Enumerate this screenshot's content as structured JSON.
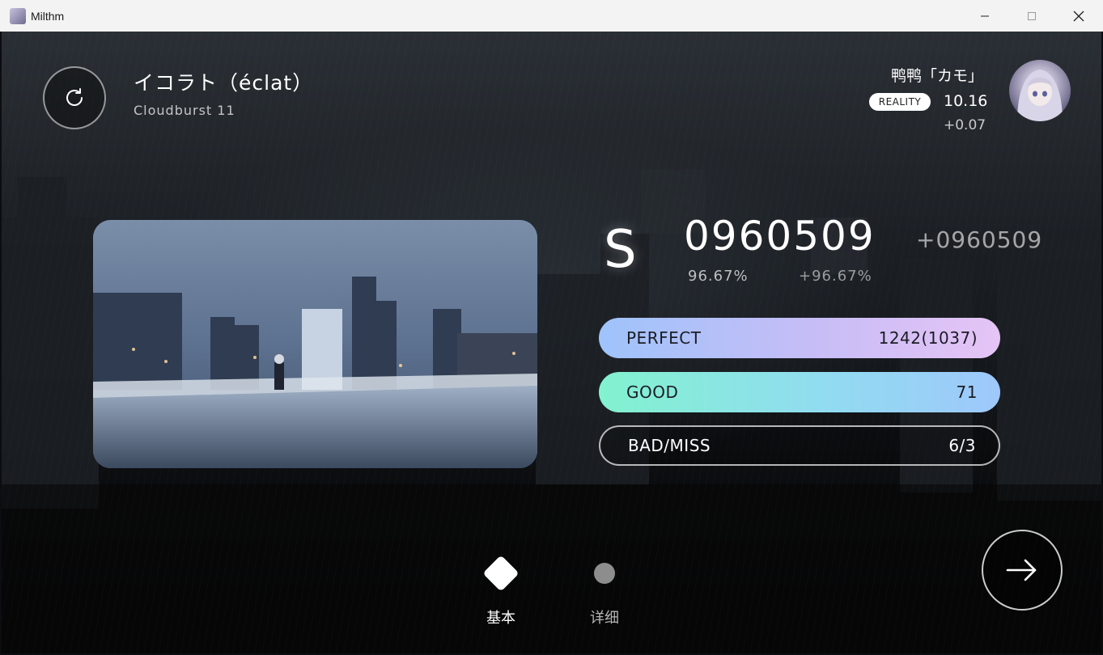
{
  "window": {
    "title": "Milthm",
    "icon": "milthm-app-icon"
  },
  "song": {
    "title": "イコラト（éclat）",
    "difficulty": "Cloudburst 11"
  },
  "player": {
    "name": "鸭鸭「カモ」",
    "reality_label": "REALITY",
    "reality_value": "10.16",
    "reality_delta": "+0.07"
  },
  "result": {
    "rank": "S",
    "score": "0960509",
    "score_delta": "+0960509",
    "accuracy": "96.67%",
    "accuracy_delta": "+96.67%"
  },
  "judgements": [
    {
      "label": "PERFECT",
      "value": "1242(1037)"
    },
    {
      "label": "GOOD",
      "value": "71"
    },
    {
      "label": "BAD/MISS",
      "value": "6/3"
    }
  ],
  "tabs": [
    {
      "label": "基本",
      "active": true
    },
    {
      "label": "详细",
      "active": false
    }
  ],
  "colors": {
    "perfect_gradient_start": "#9fc3fb",
    "perfect_gradient_end": "#e6c4f6",
    "good_gradient_start": "#82f2cf",
    "good_gradient_end": "#9ec8fb"
  }
}
